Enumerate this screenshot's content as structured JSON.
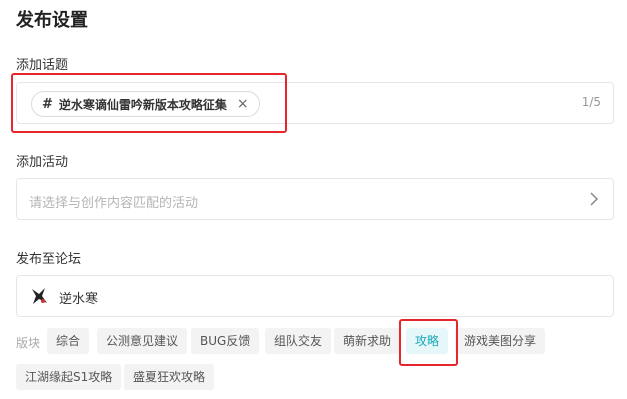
{
  "page_title": "发布设置",
  "topic": {
    "label": "添加话题",
    "chip_hash": "#",
    "chip_text": "逆水寒谪仙雷吟新版本攻略征集",
    "chip_close": "×",
    "count": "1/5"
  },
  "activity": {
    "label": "添加活动",
    "placeholder": "请选择与创作内容匹配的活动",
    "chevron": "chevron-right-icon"
  },
  "forum": {
    "label": "发布至论坛",
    "name": "逆水寒",
    "icon": "game-logo-icon"
  },
  "sections": {
    "label": "版块",
    "tags": [
      "综合",
      "公测意见建议",
      "BUG反馈",
      "组队交友",
      "萌新求助",
      "攻略",
      "游戏美图分享",
      "江湖缘起S1攻略",
      "盛夏狂欢攻略"
    ],
    "selected": "攻略"
  },
  "colors": {
    "highlight": "#e5262b",
    "active_tag_text": "#1aa9b8",
    "active_tag_bg": "#e6f7f9"
  }
}
